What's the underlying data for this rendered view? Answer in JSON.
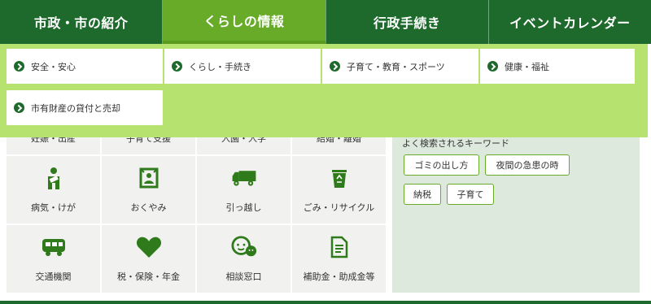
{
  "nav": {
    "items": [
      {
        "label": "市政・市の紹介"
      },
      {
        "label": "くらしの情報"
      },
      {
        "label": "行政手続き"
      },
      {
        "label": "イベントカレンダー"
      }
    ]
  },
  "dropdown": {
    "items": [
      {
        "label": "安全・安心"
      },
      {
        "label": "くらし・手続き"
      },
      {
        "label": "子育て・教育・スポーツ"
      },
      {
        "label": "健康・福祉"
      },
      {
        "label": "市有財産の貸付と売却"
      }
    ]
  },
  "tiles": {
    "partial_row": [
      {
        "label": "妊娠・出産"
      },
      {
        "label": "子育て支援"
      },
      {
        "label": "入園・入学"
      },
      {
        "label": "結婚・離婚"
      }
    ],
    "row1": [
      {
        "label": "病気・けが",
        "icon": "person-bandage-icon"
      },
      {
        "label": "おくやみ",
        "icon": "memorial-frame-icon"
      },
      {
        "label": "引っ越し",
        "icon": "truck-icon"
      },
      {
        "label": "ごみ・リサイクル",
        "icon": "recycle-bin-icon"
      }
    ],
    "row2": [
      {
        "label": "交通機関",
        "icon": "bus-icon"
      },
      {
        "label": "税・保険・年金",
        "icon": "heart-icon"
      },
      {
        "label": "相談窓口",
        "icon": "chat-bubbles-icon"
      },
      {
        "label": "補助金・助成金等",
        "icon": "document-icon"
      }
    ]
  },
  "keywords": {
    "title": "よく検索されるキーワード",
    "tags": [
      {
        "label": "ゴミの出し方"
      },
      {
        "label": "夜間の急患の時"
      },
      {
        "label": "納税"
      },
      {
        "label": "子育て"
      }
    ]
  },
  "colors": {
    "nav_bg": "#1e6a2c",
    "nav_active": "#67ab28",
    "dropdown_bg": "#b6e26f",
    "icon_green": "#2f7a1a",
    "side_bg": "#dde9dc"
  }
}
